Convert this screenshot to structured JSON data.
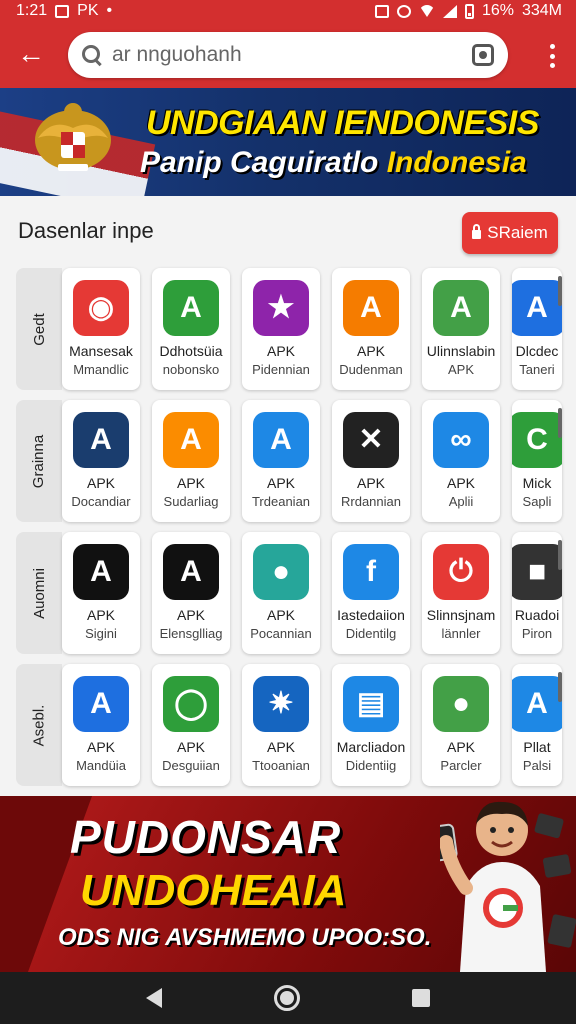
{
  "status_bar": {
    "time": "1:21",
    "carrier": "PK",
    "battery": "16%",
    "data": "334M"
  },
  "search": {
    "query": "ar nnguohanh"
  },
  "banner": {
    "title": "UNDGIAAN IENDONESIS",
    "subtitle_a": "Panip Caguiratlo",
    "subtitle_b": " Indonesia"
  },
  "section": {
    "title": "Dasenlar inpe",
    "sort_label": "SRaiem"
  },
  "rows": [
    {
      "label": "Gedt",
      "apps": [
        {
          "name": "Mansesak",
          "sub": "Mmandlic",
          "icon": "camera-icon",
          "color": "#e53935"
        },
        {
          "name": "Ddhotsüia",
          "sub": "nobonsko",
          "icon": "a-triangle-icon",
          "color": "#2e9e3a"
        },
        {
          "name": "APK",
          "sub": "Pidennian",
          "icon": "play-star-icon",
          "color": "#8e24aa"
        },
        {
          "name": "APK",
          "sub": "Dudenman",
          "icon": "a-tent-icon",
          "color": "#f57c00"
        },
        {
          "name": "Ulinnslabin",
          "sub": "APK",
          "icon": "green-a-icon",
          "color": "#43a047"
        },
        {
          "name": "Dlcdec",
          "sub": "Taneri",
          "icon": "blue-a-icon",
          "color": "#1e6fe0"
        }
      ]
    },
    {
      "label": "Grainna",
      "apps": [
        {
          "name": "APK",
          "sub": "Docandiar",
          "icon": "navy-a-icon",
          "color": "#1a3d6e"
        },
        {
          "name": "APK",
          "sub": "Sudarliag",
          "icon": "colorful-a-icon",
          "color": "#fb8c00"
        },
        {
          "name": "APK",
          "sub": "Trdeanian",
          "icon": "blue-orange-a-icon",
          "color": "#1e88e5"
        },
        {
          "name": "APK",
          "sub": "Rrdannian",
          "icon": "tool-icon",
          "color": "#222222"
        },
        {
          "name": "APK",
          "sub": "Aplii",
          "icon": "blue-link-icon",
          "color": "#1e88e5"
        },
        {
          "name": "Mick",
          "sub": "Sapli",
          "icon": "green-leaf-icon",
          "color": "#2e9e3a"
        }
      ]
    },
    {
      "label": "Auomni",
      "apps": [
        {
          "name": "APK",
          "sub": "Sigini",
          "icon": "yellow-a-icon",
          "color": "#111111"
        },
        {
          "name": "APK",
          "sub": "Elensglliag",
          "icon": "ap-icon",
          "color": "#111111"
        },
        {
          "name": "APK",
          "sub": "Pocannian",
          "icon": "green-circle-icon",
          "color": "#26a69a"
        },
        {
          "name": "Iastedaiion",
          "sub": "Didentilg",
          "icon": "f-icon",
          "color": "#1e88e5"
        },
        {
          "name": "Slinnsjnam",
          "sub": "lännler",
          "icon": "power-icon",
          "color": "#e53935"
        },
        {
          "name": "Ruadoi",
          "sub": "Piron",
          "icon": "robot-icon",
          "color": "#333333"
        }
      ]
    },
    {
      "label": "Asebl.",
      "apps": [
        {
          "name": "APK",
          "sub": "Mandüia",
          "icon": "rainbow-a-icon",
          "color": "#1e6fe0"
        },
        {
          "name": "APK",
          "sub": "Desguiian",
          "icon": "chat-bubble-icon",
          "color": "#2e9e3a"
        },
        {
          "name": "APK",
          "sub": "Ttooanian",
          "icon": "sun-gear-icon",
          "color": "#1565c0"
        },
        {
          "name": "Marcliadon",
          "sub": "Didentiig",
          "icon": "document-icon",
          "color": "#1e88e5"
        },
        {
          "name": "APK",
          "sub": "Parcler",
          "icon": "green-bag-icon",
          "color": "#43a047"
        },
        {
          "name": "Pllat",
          "sub": "Palsi",
          "icon": "light-blue-a-icon",
          "color": "#1e88e5"
        }
      ]
    }
  ],
  "promo": {
    "line1": "PUDONSAR",
    "line2": "UNDOHEAIA",
    "line3": "ODS NIG AVSHMEMO UPOO:SO."
  },
  "colors": {
    "accent": "#d32f2f",
    "sort_button": "#e53935",
    "banner_bg": "#14316b",
    "banner_text": "#ffe600"
  }
}
